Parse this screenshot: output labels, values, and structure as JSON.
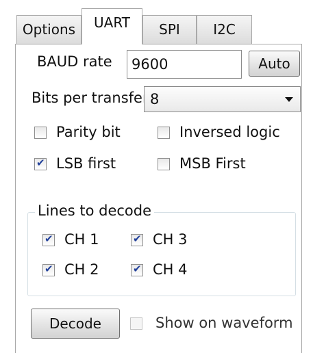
{
  "tabs": [
    {
      "label": "Options",
      "active": false
    },
    {
      "label": "UART",
      "active": true
    },
    {
      "label": "SPI",
      "active": false
    },
    {
      "label": "I2C",
      "active": false
    }
  ],
  "baud": {
    "label": "BAUD rate",
    "value": "9600",
    "auto_button": "Auto"
  },
  "bits": {
    "label": "Bits per transfer",
    "selected": "8"
  },
  "options": {
    "parity": {
      "label": "Parity bit",
      "checked": false
    },
    "inversed": {
      "label": "Inversed logic",
      "checked": false
    },
    "lsb": {
      "label": "LSB first",
      "checked": true
    },
    "msb": {
      "label": "MSB First",
      "checked": false
    }
  },
  "lines": {
    "title": "Lines to decode",
    "ch1": {
      "label": "CH 1",
      "checked": true
    },
    "ch2": {
      "label": "CH 2",
      "checked": true
    },
    "ch3": {
      "label": "CH 3",
      "checked": true
    },
    "ch4": {
      "label": "CH 4",
      "checked": true
    }
  },
  "footer": {
    "decode_button": "Decode",
    "show_waveform": {
      "label": "Show on waveform",
      "checked": false,
      "enabled": false
    }
  },
  "colors": {
    "check": "#21409a",
    "border": "#a9a9a9"
  }
}
